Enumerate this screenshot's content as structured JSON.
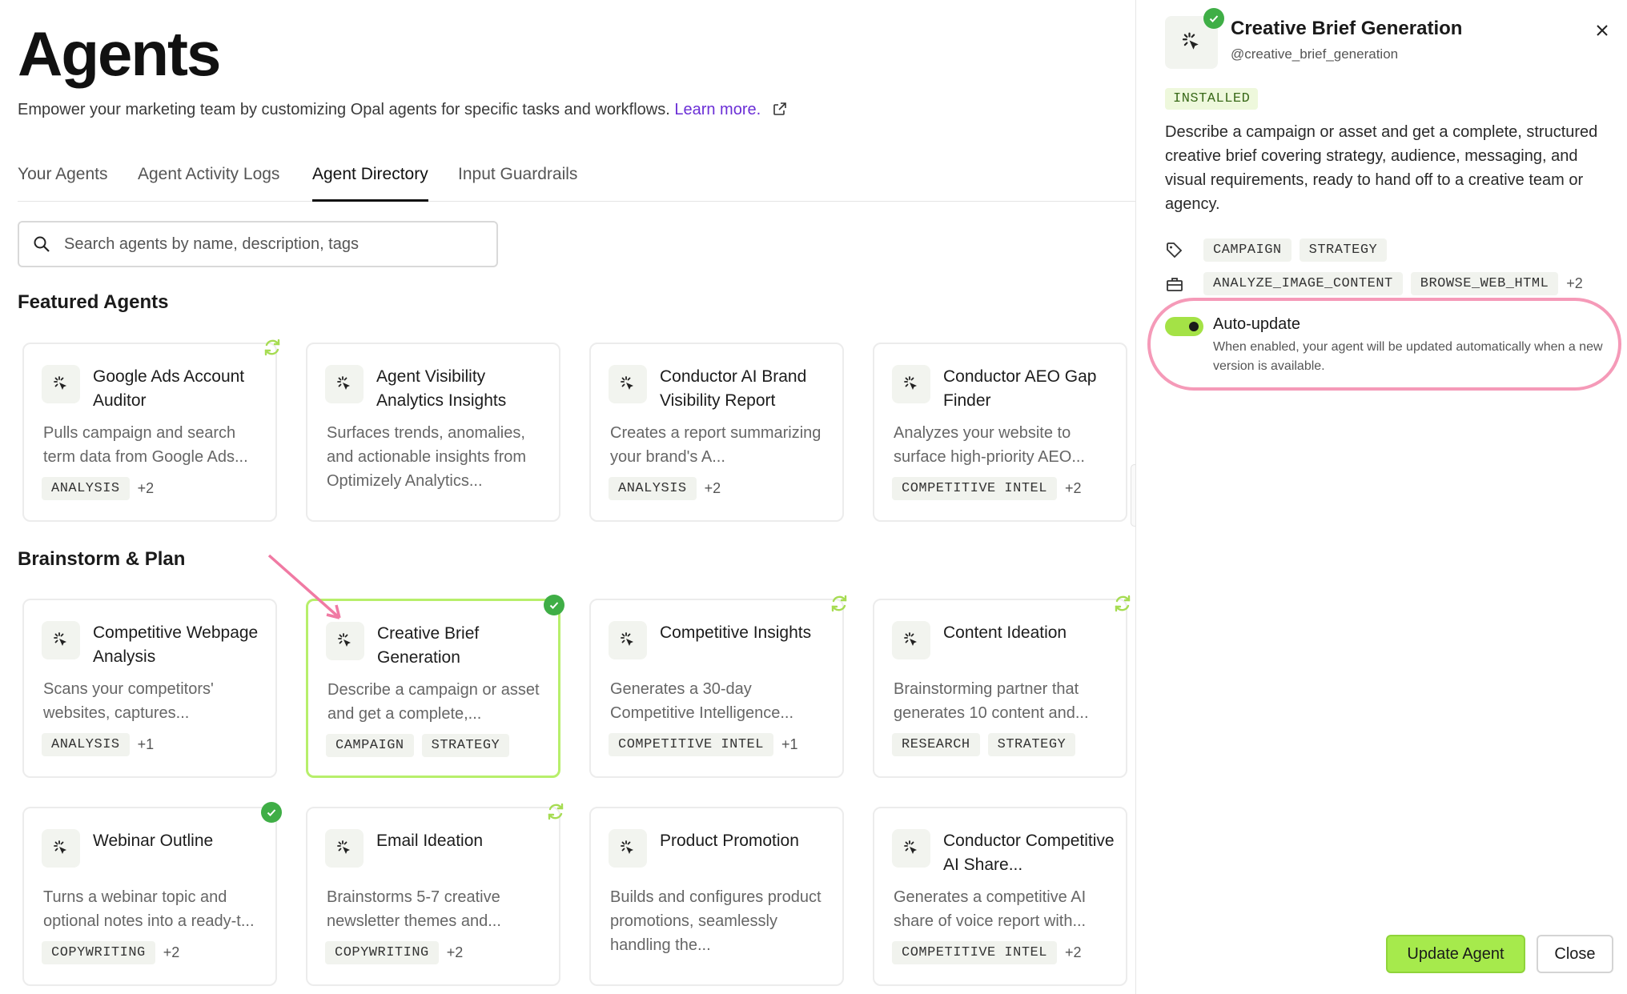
{
  "header": {
    "title": "Agents",
    "subtitle": "Empower your marketing team by customizing Opal agents for specific tasks and workflows.",
    "learn_more": "Learn more."
  },
  "tabs": [
    {
      "label": "Your Agents",
      "active": false
    },
    {
      "label": "Agent Activity Logs",
      "active": false
    },
    {
      "label": "Agent Directory",
      "active": true
    },
    {
      "label": "Input Guardrails",
      "active": false
    }
  ],
  "search": {
    "placeholder": "Search agents by name, description, tags",
    "value": ""
  },
  "sections": {
    "featured": "Featured Agents",
    "brainstorm": "Brainstorm & Plan"
  },
  "featured_cards": [
    {
      "title": "Google Ads Account Auditor",
      "desc": "Pulls campaign and search term data from Google Ads...",
      "tags": [
        "ANALYSIS"
      ],
      "more": "+2",
      "badge": "sync"
    },
    {
      "title": "Agent Visibility Analytics Insights",
      "desc": "Surfaces trends, anomalies, and actionable insights from Optimizely Analytics...",
      "tags": [],
      "more": "",
      "badge": ""
    },
    {
      "title": "Conductor AI Brand Visibility Report",
      "desc": "Creates a report summarizing your brand's A...",
      "tags": [
        "ANALYSIS"
      ],
      "more": "+2",
      "badge": ""
    },
    {
      "title": "Conductor AEO Gap Finder",
      "desc": "Analyzes your website to surface high-priority AEO...",
      "tags": [
        "COMPETITIVE INTEL"
      ],
      "more": "+2",
      "badge": ""
    }
  ],
  "brainstorm_cards": [
    {
      "title": "Competitive Webpage Analysis",
      "desc": "Scans your competitors' websites, captures...",
      "tags": [
        "ANALYSIS"
      ],
      "more": "+1",
      "badge": ""
    },
    {
      "title": "Creative Brief Generation",
      "desc": "Describe a campaign or asset and get a complete,...",
      "tags": [
        "CAMPAIGN",
        "STRATEGY"
      ],
      "more": "",
      "badge": "check"
    },
    {
      "title": "Competitive Insights",
      "desc": "Generates a 30-day Competitive Intelligence...",
      "tags": [
        "COMPETITIVE INTEL"
      ],
      "more": "+1",
      "badge": "sync"
    },
    {
      "title": "Content Ideation",
      "desc": "Brainstorming partner that generates 10 content and...",
      "tags": [
        "RESEARCH",
        "STRATEGY"
      ],
      "more": "",
      "badge": "sync"
    }
  ],
  "row3_cards": [
    {
      "title": "Webinar Outline",
      "desc": "Turns a webinar topic and optional notes into a ready-t...",
      "tags": [
        "COPYWRITING"
      ],
      "more": "+2",
      "badge": "check"
    },
    {
      "title": "Email Ideation",
      "desc": "Brainstorms 5-7 creative newsletter themes and...",
      "tags": [
        "COPYWRITING"
      ],
      "more": "+2",
      "badge": "sync"
    },
    {
      "title": "Product Promotion",
      "desc": "Builds and configures product promotions, seamlessly handling the...",
      "tags": [],
      "more": "",
      "badge": ""
    },
    {
      "title": "Conductor Competitive AI Share...",
      "desc": "Generates a competitive AI share of voice report with...",
      "tags": [
        "COMPETITIVE INTEL"
      ],
      "more": "+2",
      "badge": ""
    }
  ],
  "panel": {
    "title": "Creative Brief Generation",
    "handle": "@creative_brief_generation",
    "status": "INSTALLED",
    "description": "Describe a campaign or asset and get a complete, structured creative brief covering strategy, audience, messaging, and visual requirements, ready to hand off to a creative team or agency.",
    "tags": [
      "CAMPAIGN",
      "STRATEGY"
    ],
    "tools": [
      "ANALYZE_IMAGE_CONTENT",
      "BROWSE_WEB_HTML"
    ],
    "tools_more": "+2",
    "auto_update_title": "Auto-update",
    "auto_update_desc": "When enabled, your agent will be updated automatically when a new version is available.",
    "auto_update_enabled": true,
    "update_button": "Update Agent",
    "close_button": "Close"
  },
  "colors": {
    "accent_green": "#a6ea4c",
    "check_green": "#3fae46",
    "link_purple": "#6b2fd6",
    "highlight_pink": "#f59ab8"
  }
}
